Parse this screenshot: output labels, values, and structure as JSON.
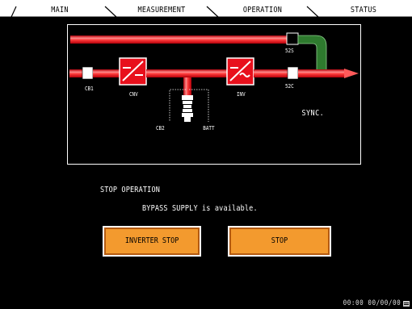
{
  "tabs": [
    {
      "label": "MAIN",
      "active": true
    },
    {
      "label": "MEASUREMENT",
      "active": false
    },
    {
      "label": "OPERATION",
      "active": false
    },
    {
      "label": "STATUS",
      "active": false
    }
  ],
  "diagram": {
    "labels": {
      "cb1": "CB1",
      "cnv": "CNV",
      "cb2": "CB2",
      "batt": "BATT",
      "inv": "INV",
      "s52s": "52S",
      "s52c": "52C",
      "sync": "SYNC."
    },
    "colors": {
      "bus": "#e8101c",
      "bus_highlight": "#ff9a9a",
      "bypass_path": "#2e7a2e",
      "breaker_open": "#ffffff",
      "breaker_closed": "#000000"
    }
  },
  "messages": {
    "status": "STOP OPERATION",
    "detail": "BYPASS SUPPLY is available."
  },
  "buttons": {
    "inverter_stop": "INVERTER STOP",
    "stop": "STOP"
  },
  "statusbar": {
    "clock": "00:00 00/00/00"
  }
}
